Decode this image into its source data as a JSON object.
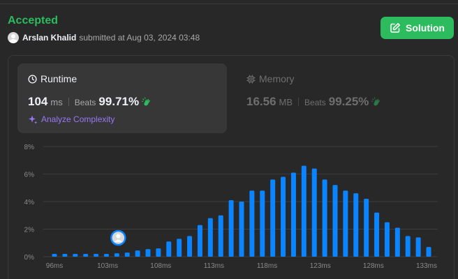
{
  "submission": {
    "status": "Accepted",
    "user": "Arslan Khalid",
    "submitted_text": "submitted at Aug 03, 2024 03:48",
    "solution_label": "Solution"
  },
  "runtime": {
    "title": "Runtime",
    "value": "104",
    "unit": "ms",
    "beats_label": "Beats",
    "beats": "99.71%",
    "analyze_label": "Analyze Complexity"
  },
  "memory": {
    "title": "Memory",
    "value": "16.56",
    "unit": "MB",
    "beats_label": "Beats",
    "beats": "99.25%"
  },
  "colors": {
    "accepted": "#2cbb5d",
    "bar": "#0a84ff",
    "analyze": "#9977f7"
  },
  "chart_data": {
    "type": "bar",
    "yticks": [
      "8%",
      "6%",
      "4%",
      "2%",
      "0%"
    ],
    "xticks": [
      "96ms",
      "103ms",
      "108ms",
      "113ms",
      "118ms",
      "123ms",
      "128ms",
      "133ms"
    ],
    "values": [
      0.2,
      0.2,
      0.2,
      0.2,
      0.2,
      0.2,
      0.25,
      0.3,
      0.45,
      0.55,
      0.6,
      1.1,
      1.3,
      1.5,
      2.3,
      2.8,
      3.0,
      4.1,
      4.0,
      4.8,
      4.8,
      5.6,
      5.8,
      6.1,
      6.6,
      6.4,
      5.6,
      5.2,
      4.8,
      4.6,
      4.2,
      3.2,
      2.5,
      2.1,
      1.5,
      1.4,
      0.7
    ],
    "ylim": [
      0,
      8
    ],
    "highlight_index": 6,
    "highlight_marker": "user-avatar"
  }
}
